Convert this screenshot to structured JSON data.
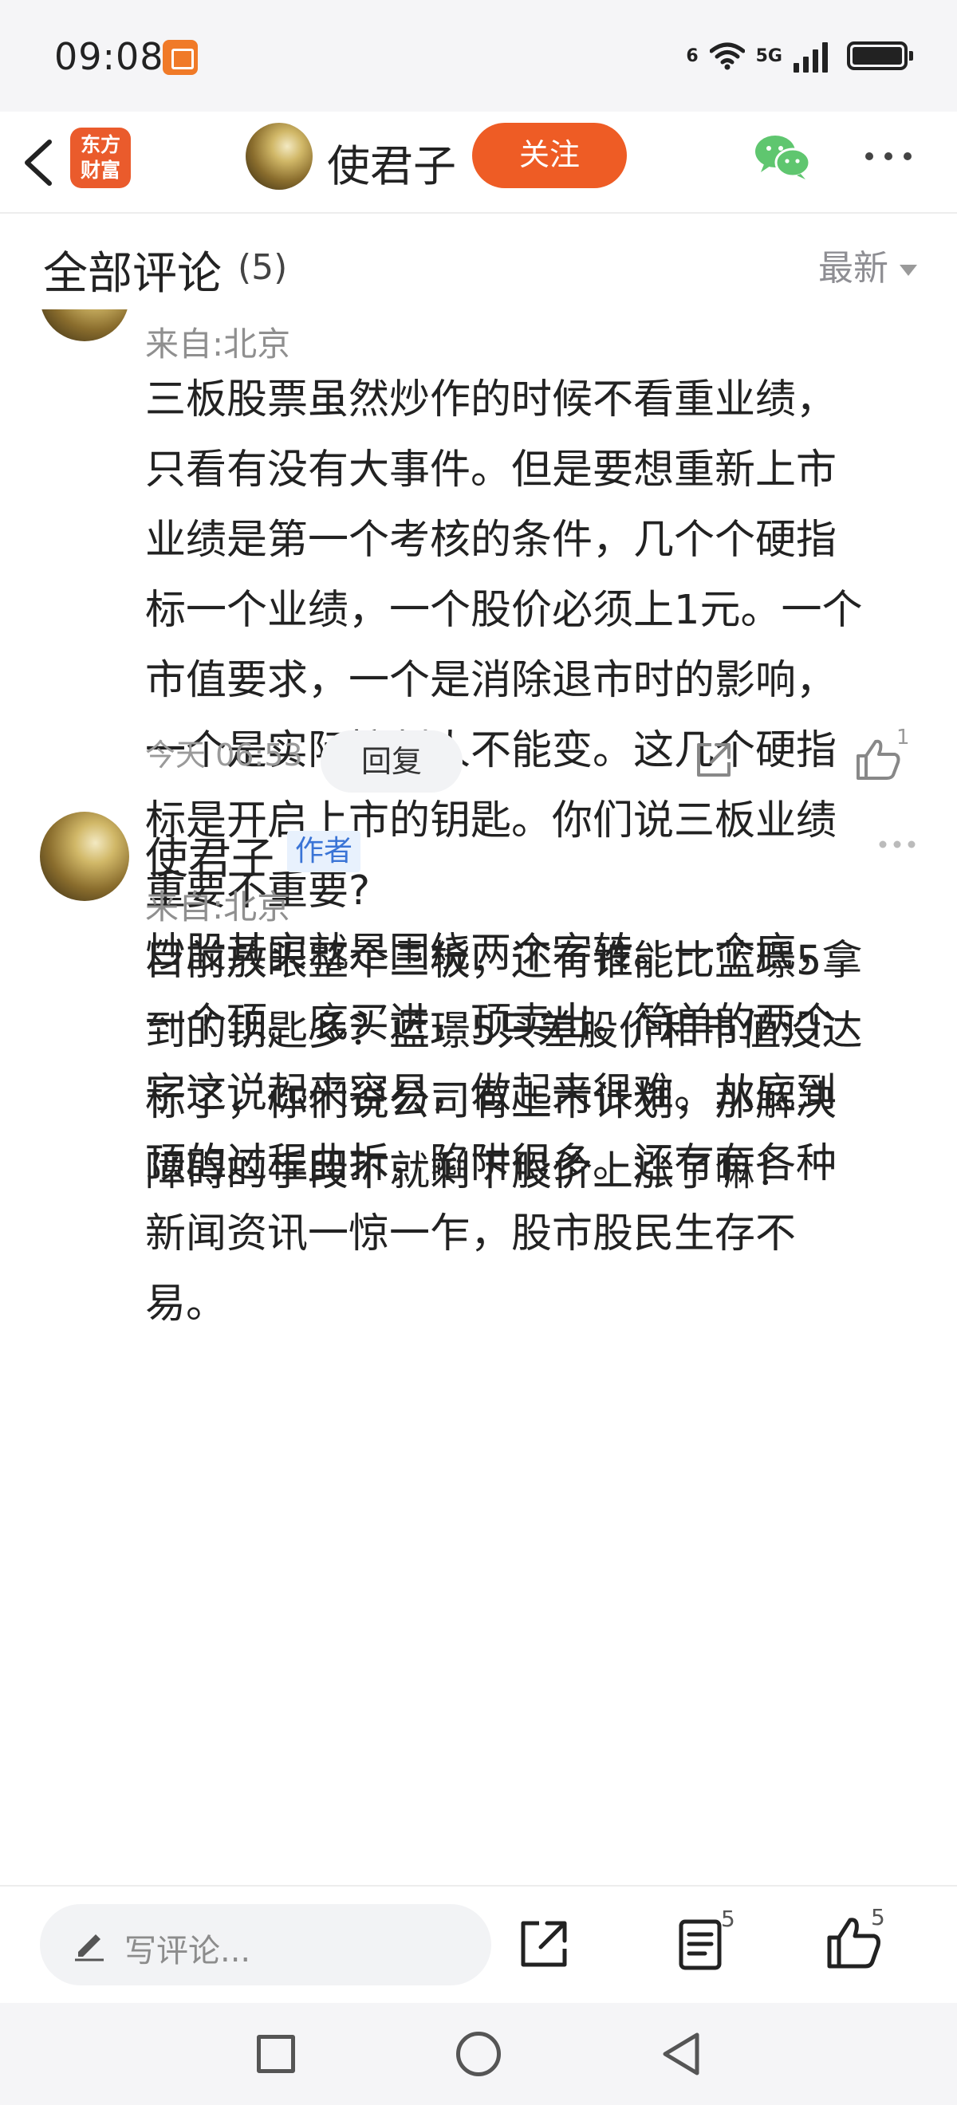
{
  "status_bar": {
    "time": "09:08",
    "wifi_label": "6",
    "network_label": "5G",
    "icons": [
      "app-notification-icon",
      "wifi-icon",
      "signal-icon",
      "battery-icon"
    ]
  },
  "nav": {
    "logo_line1": "东方",
    "logo_line2": "财富",
    "user_name": "使君子",
    "follow_label": "关注",
    "accent_color": "#ee5c25",
    "icons": [
      "back-arrow-icon",
      "wechat-icon",
      "more-icon"
    ]
  },
  "comments_header": {
    "title": "全部评论",
    "count": "(5)",
    "sort_label": "最新"
  },
  "comments": [
    {
      "location": "来自:北京",
      "text": "三板股票虽然炒作的时候不看重业绩，\n只看有没有大事件。但是要想重新上市\n业绩是第一个考核的条件，几个个硬指\n标一个业绩，一个股价必须上1元。一个\n市值要求，一个是消除退市时的影响，\n一个是实际控制人不能变。这几个硬指\n标是开启上市的钥匙。你们说三板业绩\n重要不重要?\n目前放眼整个三板，还有谁能比蓝璟5拿\n到的钥匙多？蓝璟5只差股价和市值没达\n标了，你们说公司有上市计划，那解决\n障碍的手段不就剩下股价上涨了嘛！",
      "time": "今天 06:53",
      "reply_label": "回复",
      "like_count": "1"
    },
    {
      "name": "使君子",
      "author_tag": "作者",
      "location": "来自:北京",
      "text": "炒股其实就是围绕两个字转。一个底，\n一个顶。底买进，顶卖出。简单的两个\n字这说起来容易，做起来很难。从底到\n顶的过程曲折，陷阱很多。还有有各种\n新闻资讯一惊一乍，股市股民生存不\n易。"
    }
  ],
  "bottom_bar": {
    "placeholder": "写评论...",
    "comment_count": "5",
    "like_count": "5"
  }
}
